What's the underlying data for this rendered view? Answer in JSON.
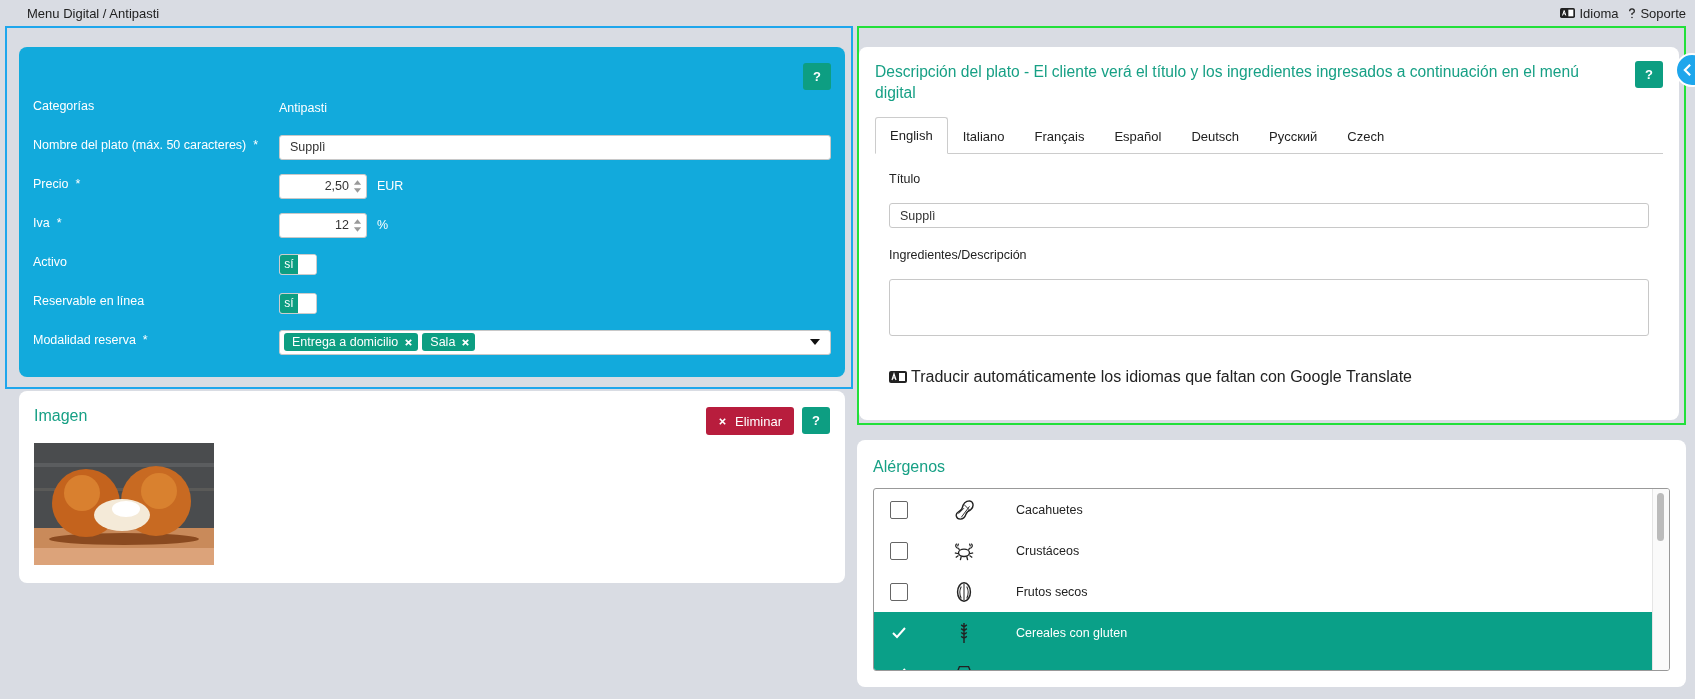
{
  "breadcrumb": "Menu Digital / Antipasti",
  "top_links": [
    {
      "kind": "language",
      "label": "Idioma"
    },
    {
      "kind": "help",
      "label": "Soporte"
    }
  ],
  "dish_form": {
    "help": "?",
    "fields": [
      {
        "kind": "static",
        "label": "Categorías",
        "value": "Antipasti"
      },
      {
        "kind": "text",
        "label": "Nombre del plato (máx. 50 caracteres)",
        "required_mark": "*",
        "value": "Supplì"
      },
      {
        "kind": "number",
        "label": "Precio",
        "required_mark": "*",
        "value": "2,50",
        "unit": "EUR"
      },
      {
        "kind": "number",
        "label": "Iva",
        "required_mark": "*",
        "value": "12",
        "unit": "%"
      },
      {
        "kind": "toggle",
        "label": "Activo",
        "on": true,
        "toggle_label": "sí"
      },
      {
        "kind": "toggle",
        "label": "Reservable en línea",
        "on": true,
        "toggle_label": "sí"
      },
      {
        "kind": "tags",
        "label": "Modalidad reserva",
        "required_mark": "*",
        "tags": [
          "Entrega a domicilio",
          "Sala"
        ]
      }
    ]
  },
  "image_card": {
    "title": "Imagen",
    "delete_button": "Eliminar",
    "help": "?"
  },
  "description": {
    "title": "Descripción del plato - El cliente verá el título y los ingredientes ingresados a continuación en el menú digital",
    "help": "?",
    "tabs": [
      {
        "label": "English",
        "selected": true
      },
      {
        "label": "Italiano",
        "selected": false
      },
      {
        "label": "Français",
        "selected": false
      },
      {
        "label": "Español",
        "selected": false
      },
      {
        "label": "Deutsch",
        "selected": false
      },
      {
        "label": "Русский",
        "selected": false
      },
      {
        "label": "Czech",
        "selected": false
      }
    ],
    "title_label": "Título",
    "title_value": "Supplì",
    "description_label": "Ingredientes/Descripción",
    "translate_link": "Traducir automáticamente los idiomas que faltan con Google Translate"
  },
  "allergens": {
    "title": "Alérgenos",
    "items": [
      {
        "kind": "peanut",
        "label": "Cacahuetes",
        "checked": false
      },
      {
        "kind": "crab",
        "label": "Crustáceos",
        "checked": false
      },
      {
        "kind": "nut",
        "label": "Frutos secos",
        "checked": false
      },
      {
        "kind": "wheat",
        "label": "Cereales con gluten",
        "checked": true
      },
      {
        "kind": "milk",
        "checked": true
      }
    ]
  }
}
